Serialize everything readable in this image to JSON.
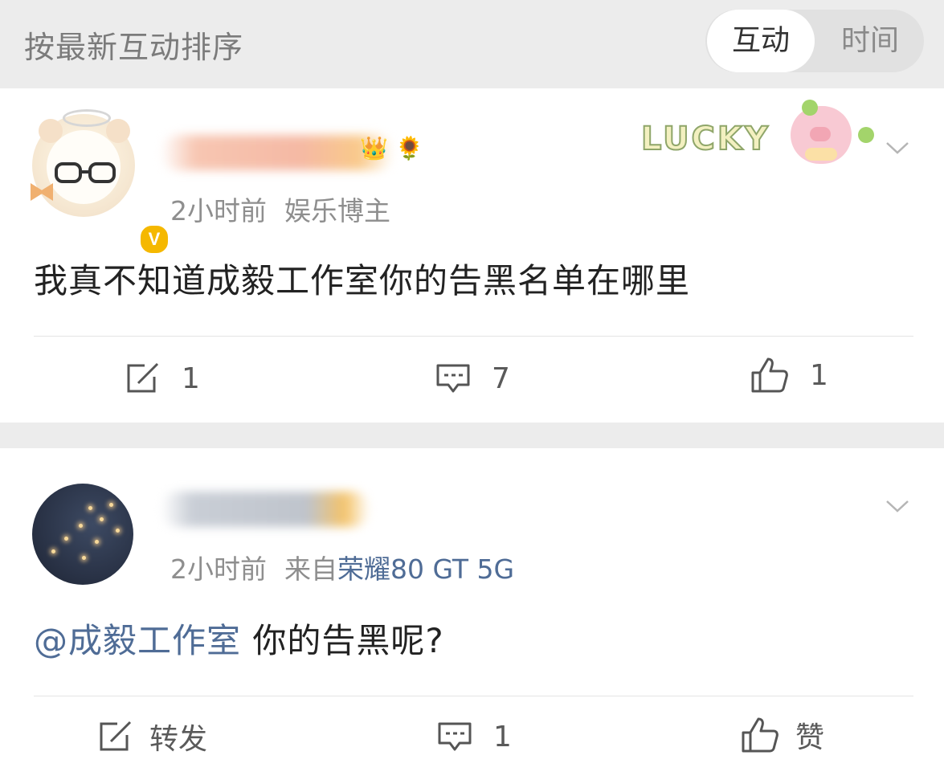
{
  "sort_bar": {
    "title": "按最新互动排序",
    "tabs": [
      {
        "label": "互动",
        "active": true
      },
      {
        "label": "时间",
        "active": false
      }
    ]
  },
  "comments": [
    {
      "time": "2小时前",
      "tag": "娱乐博主",
      "verified_badge": "V",
      "decoration_text": "LUCKY",
      "content": "我真不知道成毅工作室你的告黑名单在哪里",
      "actions": {
        "repost": "1",
        "comment": "7",
        "like": "1"
      }
    },
    {
      "time": "2小时前",
      "source_prefix": "来自",
      "source_model": "荣耀80 GT 5G",
      "mention": "@成毅工作室",
      "content": " 你的告黑呢?",
      "actions": {
        "repost": "转发",
        "comment": "1",
        "like": "赞"
      }
    }
  ],
  "colors": {
    "background": "#ececec",
    "card": "#ffffff",
    "link": "#4f6c96",
    "verified": "#f5b800"
  },
  "icons": [
    "repost-icon",
    "comment-icon",
    "like-icon",
    "chevron-down-icon",
    "verified-icon"
  ]
}
